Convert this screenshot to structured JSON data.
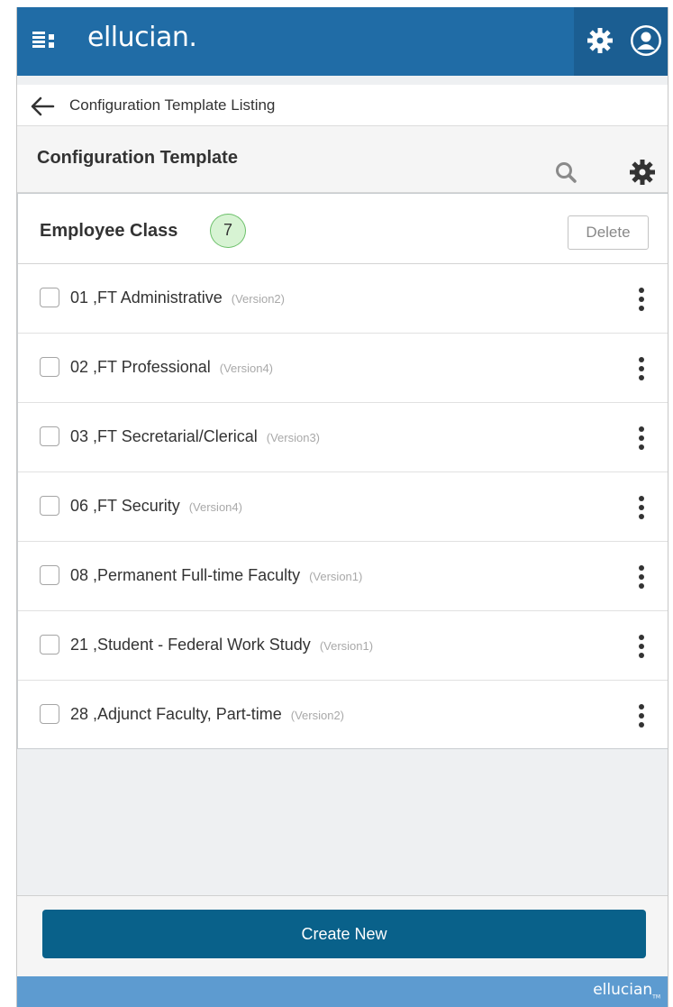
{
  "header": {
    "brand": "ellucian.",
    "icons": [
      "apps-icon",
      "gear-icon",
      "user-icon"
    ],
    "colors": {
      "primary": "#206ca6",
      "primary_dark": "#1b5e92"
    }
  },
  "nav": {
    "back_label": "Configuration Template Listing"
  },
  "page": {
    "title": "Configuration Template"
  },
  "list": {
    "title": "Employee Class",
    "count": "7",
    "delete_label": "Delete",
    "items": [
      {
        "label": "01 ,FT Administrative",
        "version": "(Version2)"
      },
      {
        "label": "02 ,FT Professional",
        "version": "(Version4)"
      },
      {
        "label": "03 ,FT Secretarial/Clerical",
        "version": "(Version3)"
      },
      {
        "label": "06 ,FT Security",
        "version": "(Version4)"
      },
      {
        "label": "08 ,Permanent Full-time Faculty",
        "version": "(Version1)"
      },
      {
        "label": "21 ,Student - Federal Work Study",
        "version": "(Version1)"
      },
      {
        "label": "28 ,Adjunct Faculty, Part-time",
        "version": "(Version2)"
      }
    ]
  },
  "footer": {
    "create_label": "Create New",
    "brand": "ellucian",
    "brand_mark": "TM",
    "button_color": "#09618a"
  }
}
